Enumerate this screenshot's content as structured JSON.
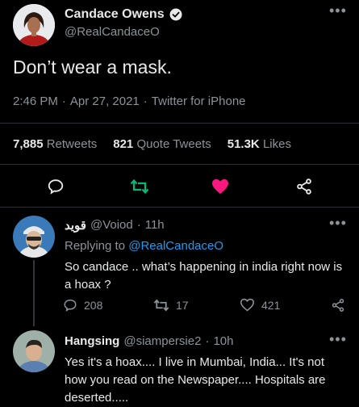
{
  "main_tweet": {
    "author": {
      "name": "Candace Owens",
      "handle": "@RealCandaceO",
      "verified_icon": "verified-badge-icon"
    },
    "text": "Don’t wear a mask.",
    "time": "2:46 PM",
    "date": "Apr 27, 2021",
    "source": "Twitter for iPhone",
    "stats": {
      "retweets_count": "7,885",
      "retweets_label": "Retweets",
      "quotes_count": "821",
      "quotes_label": "Quote Tweets",
      "likes_count": "51.3K",
      "likes_label": "Likes"
    },
    "actions": {
      "reply_icon": "reply-icon",
      "retweet_icon": "retweet-icon",
      "like_icon": "heart-icon",
      "share_icon": "share-icon",
      "colors": {
        "retweet": "#00ba7c",
        "like": "#f91880"
      }
    }
  },
  "replies": [
    {
      "name": "قويد",
      "handle": "@Voiod",
      "time": "11h",
      "replying_to_label": "Replying to",
      "replying_to": "@RealCandaceO",
      "text": "So candace .. what’s happening in india right now is a hoax ?",
      "reply_count": "208",
      "retweet_count": "17",
      "like_count": "421"
    },
    {
      "name": "Hangsing",
      "handle": "@siampersie2",
      "time": "10h",
      "text": "Yes it's a hoax.... I live in Mumbai, India... It's not how you read on the Newspaper.... Hospitals are deserted....."
    }
  ],
  "separators": {
    "dot": "·",
    "more_icon": "more-icon"
  }
}
